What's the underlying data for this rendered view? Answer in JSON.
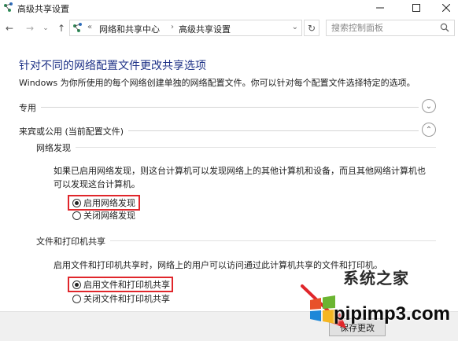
{
  "window": {
    "title": "高级共享设置"
  },
  "navigation": {
    "back": "←",
    "forward": "→",
    "recent": "⌄",
    "up": "↑",
    "breadcrumb_prefix": "«",
    "breadcrumbs": [
      "网络和共享中心",
      "高级共享设置"
    ],
    "separator": "›",
    "refresh": "↻",
    "search_placeholder": "搜索控制面板"
  },
  "page": {
    "title": "针对不同的网络配置文件更改共享选项",
    "description": "Windows 为你所使用的每个网络创建单独的网络配置文件。你可以针对每个配置文件选择特定的选项。"
  },
  "profiles": {
    "private": {
      "label": "专用",
      "expanded": false
    },
    "guest": {
      "label": "来宾或公用 (当前配置文件)",
      "expanded": true
    }
  },
  "network_discovery": {
    "header": "网络发现",
    "description": "如果已启用网络发现，则这台计算机可以发现网络上的其他计算机和设备，而且其他网络计算机也可以发现这台计算机。",
    "option_on": "启用网络发现",
    "option_off": "关闭网络发现",
    "selected": "on"
  },
  "file_printer_sharing": {
    "header": "文件和打印机共享",
    "description": "启用文件和打印机共享时，网络上的用户可以访问通过此计算机共享的文件和打印机。",
    "option_on": "启用文件和打印机共享",
    "option_off": "关闭文件和打印机共享",
    "selected": "on"
  },
  "footer": {
    "save_label": "保存更改"
  },
  "watermark": {
    "brand": "系统之家",
    "url": "pipimp3.com"
  },
  "colors": {
    "title_blue": "#1e3287",
    "highlight_red": "#e0262b"
  }
}
